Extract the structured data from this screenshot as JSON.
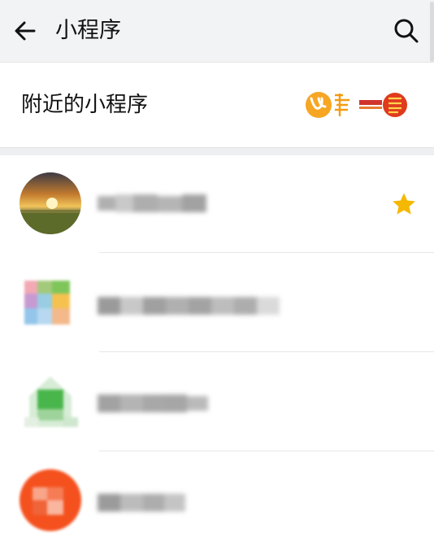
{
  "header": {
    "title": "小程序",
    "back_icon": "arrow-left-icon",
    "search_icon": "search-icon"
  },
  "nearby": {
    "label": "附近的小程序"
  },
  "list": {
    "items": [
      {
        "name": "",
        "avatar": "sunset-landscape",
        "starred": true
      },
      {
        "name": "",
        "avatar": "colorful-grid",
        "starred": false
      },
      {
        "name": "",
        "avatar": "green-house",
        "starred": false
      },
      {
        "name": "",
        "avatar": "red-circle",
        "starred": false
      }
    ]
  },
  "colors": {
    "header_bg": "#f2f3f5",
    "star": "#f5b800",
    "divider": "#e6e6e6"
  }
}
